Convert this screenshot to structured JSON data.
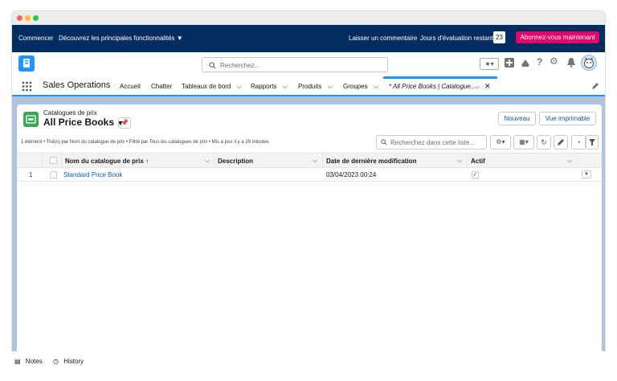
{
  "trial_bar": {
    "start": "Commencer",
    "discover": "Découvrez les principales fonctionnalités",
    "feedback": "Laisser un commentaire",
    "days_label": "Jours d'évaluation restants",
    "days_count": "23",
    "subscribe": "Abonnez-vous maintenant"
  },
  "search": {
    "placeholder": "Recherchez..."
  },
  "nav": {
    "app_name": "Sales Operations",
    "items": [
      {
        "label": "Accueil"
      },
      {
        "label": "Chatter"
      },
      {
        "label": "Tableaux de bord"
      },
      {
        "label": "Rapports"
      },
      {
        "label": "Produits"
      },
      {
        "label": "Groupes"
      }
    ],
    "active_tab": "* All Price Books | Catalogue..."
  },
  "list": {
    "object_label": "Catalogues de prix",
    "view_name": "All Price Books",
    "new_button": "Nouveau",
    "print_button": "Vue imprimable",
    "summary": "1 élément • Trié(s) par Nom du catalogue de prix • Filtré par Tous les catalogues de prix • Mis à jour il y a 29 minutes",
    "search_placeholder": "Recherchez dans cette liste...",
    "columns": {
      "name": "Nom du catalogue de prix ↑",
      "description": "Description",
      "modified": "Date de dernière modification",
      "active": "Actif"
    },
    "rows": [
      {
        "num": "1",
        "name": "Standard Price Book",
        "description": "",
        "modified": "03/04/2023 00:24",
        "active": true
      }
    ]
  },
  "footer": {
    "notes": "Notes",
    "history": "History"
  },
  "colors": {
    "brand_navy": "#032d60",
    "brand_blue": "#1b96ff",
    "subscribe_pink": "#e3066a",
    "link": "#0b5cab"
  }
}
